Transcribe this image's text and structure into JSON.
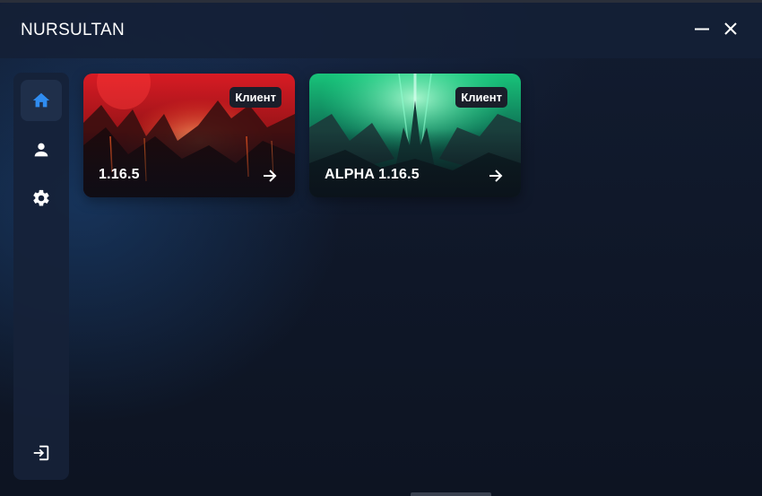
{
  "app": {
    "title": "NURSULTAN"
  },
  "window_controls": {
    "minimize_icon": "minimize-icon",
    "close_icon": "close-icon"
  },
  "sidebar": {
    "items": [
      {
        "id": "home",
        "icon": "home-icon",
        "active": true
      },
      {
        "id": "profile",
        "icon": "user-icon",
        "active": false
      },
      {
        "id": "settings",
        "icon": "gear-icon",
        "active": false
      }
    ],
    "logout": {
      "icon": "logout-icon"
    }
  },
  "cards": [
    {
      "label": "1.16.5",
      "badge": "Клиент",
      "theme": "red-volcanic",
      "icon": "arrow-right-icon"
    },
    {
      "label": "ALPHA 1.16.5",
      "badge": "Клиент",
      "theme": "green-aurora",
      "icon": "arrow-right-icon"
    }
  ],
  "colors": {
    "accent": "#2f8cf0",
    "background": "#0f1728",
    "panel": "#162238",
    "text": "#ffffff"
  }
}
